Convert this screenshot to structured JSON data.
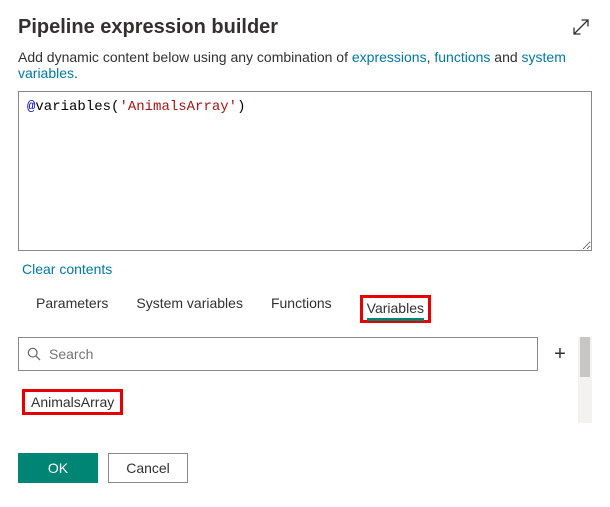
{
  "header": {
    "title": "Pipeline expression builder"
  },
  "hint": {
    "prefix": "Add dynamic content below using any combination of ",
    "link1": "expressions",
    "sep1": ", ",
    "link2": "functions",
    "sep2": " and ",
    "link3": "system variables",
    "suffix": "."
  },
  "editor": {
    "at": "@",
    "fn": "variables",
    "open": "(",
    "q1": "'",
    "arg": "AnimalsArray",
    "q2": "'",
    "close": ")"
  },
  "clear": "Clear contents",
  "tabs": {
    "parameters": "Parameters",
    "system_variables": "System variables",
    "functions": "Functions",
    "variables": "Variables"
  },
  "search": {
    "placeholder": "Search"
  },
  "plus": "+",
  "variable_item": "AnimalsArray",
  "buttons": {
    "ok": "OK",
    "cancel": "Cancel"
  }
}
